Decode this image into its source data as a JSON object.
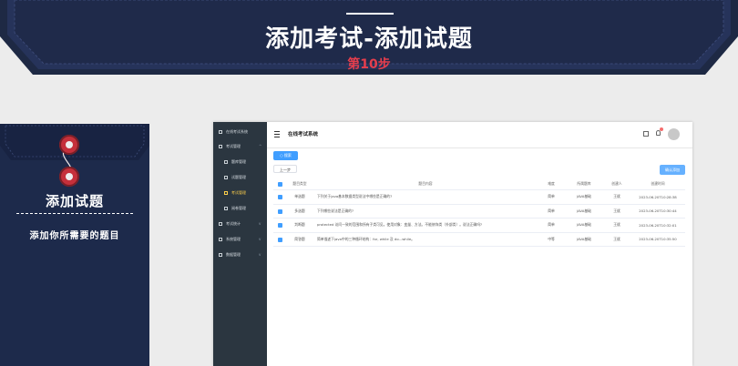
{
  "banner": {
    "title": "添加考试-添加试题",
    "step": "第10步"
  },
  "envelope": {
    "title": "添加试题",
    "subtitle": "添加你所需要的题目"
  },
  "app": {
    "sidebar": {
      "brand": "在线考试系统",
      "items": [
        {
          "label": "考试管理"
        },
        {
          "label": "题库管理"
        },
        {
          "label": "试题管理"
        },
        {
          "label": "考试管理"
        },
        {
          "label": "阅卷管理"
        },
        {
          "label": "考试统计"
        },
        {
          "label": "系统管理"
        },
        {
          "label": "数据管理"
        }
      ]
    },
    "header": {
      "title": "在线考试系统"
    },
    "toolbar": {
      "search_label": "搜索",
      "prev_label": "上一步",
      "confirm_label": "确认添加"
    },
    "table": {
      "columns": [
        "题目类型",
        "题目内容",
        "难度",
        "所属题库",
        "创建人",
        "创建时间"
      ],
      "rows": [
        {
          "type": "单选题",
          "content": "下列关于java基本数据类型说法中哪些是正确的?",
          "difficulty": "简单",
          "bank": "JAVA基础",
          "creator": "王斌",
          "time": "2023-06-20T10:28:38"
        },
        {
          "type": "多选题",
          "content": "下列哪些说法是正确的?",
          "difficulty": "简单",
          "bank": "JAVA基础",
          "creator": "王斌",
          "time": "2023-06-20T10:30:44"
        },
        {
          "type": "判断题",
          "content": "protected 访问一致的范围和所有子类可见。使用对象：变量、方法。不能修饰类（外部类）。说法正确吗?",
          "difficulty": "简单",
          "bank": "JAVA基础",
          "creator": "王斌",
          "time": "2023-06-20T10:32:01"
        },
        {
          "type": "简答题",
          "content": "简单描述下java中的三种循环结构：for, while 及 do...while。",
          "difficulty": "中等",
          "bank": "JAVA基础",
          "creator": "王斌",
          "time": "2023-06-20T10:35:50"
        }
      ]
    }
  },
  "colors": {
    "banner_bg": "#1f2a4a",
    "envelope_bg": "#1d2a4b",
    "accent_red": "#e63e4d",
    "primary_blue": "#409eff",
    "sidebar_bg": "#2b3640",
    "sidebar_active": "#ffd04b"
  },
  "icons": {
    "menu": "hamburger-icon",
    "fullscreen": "fullscreen-icon",
    "bell": "bell-icon",
    "search": "search-icon"
  }
}
